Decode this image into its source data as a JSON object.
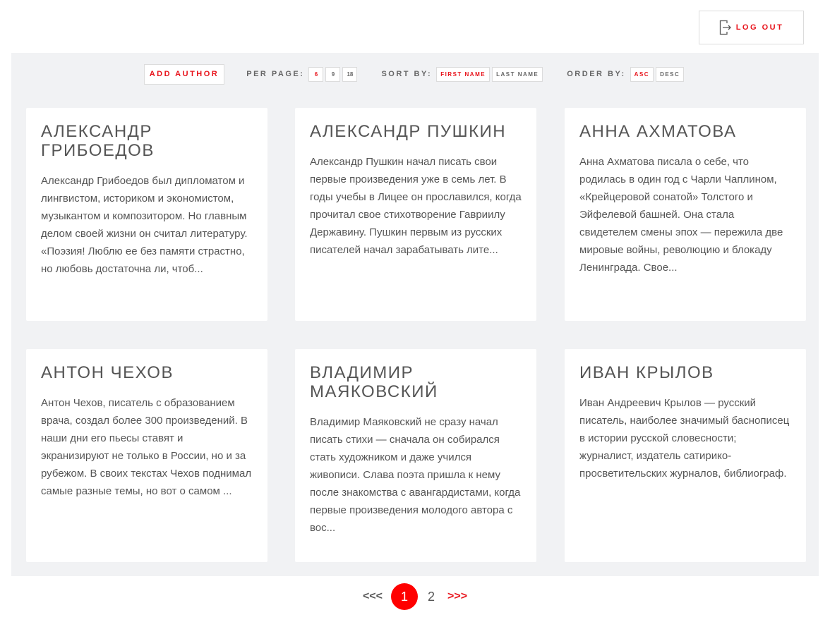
{
  "header": {
    "logout_label": "LOG OUT"
  },
  "toolbar": {
    "add_author_label": "ADD AUTHOR",
    "per_page_label": "PER PAGE:",
    "per_page_options": [
      "6",
      "9",
      "18"
    ],
    "sort_by_label": "SORT BY:",
    "sort_options": [
      "FIRST NAME",
      "LAST NAME"
    ],
    "order_by_label": "ORDER BY:",
    "order_options": [
      "ASC",
      "DESC"
    ]
  },
  "authors": [
    {
      "name": "Александр Грибоедов",
      "description": "Александр Грибоедов был дипломатом и лингвистом, историком и экономистом, музыкантом и композитором. Но главным делом своей жизни он считал литературу. «Поэзия! Люблю ее без памяти страстно, но любовь достаточна ли, чтоб..."
    },
    {
      "name": "Александр Пушкин",
      "description": "Александр Пушкин начал писать свои первые произведения уже в семь лет. В годы учебы в Лицее он прославился, когда прочитал свое стихотворение Гавриилу Державину. Пушкин первым из русских писателей начал зарабатывать лите..."
    },
    {
      "name": "Анна Ахматова",
      "description": "Анна Ахматова писала о себе, что родилась в один год с Чарли Чаплином, «Крейцеровой сонатой» Толстого и Эйфелевой башней. Она стала свидетелем смены эпох — пережила две мировые войны, революцию и блокаду Ленинграда. Свое..."
    },
    {
      "name": "Антон Чехов",
      "description": "Антон Чехов, писатель с образованием врача, создал более 300 произведений. В наши дни его пьесы ставят и экранизируют не только в России, но и за рубежом. В своих текстах Чехов поднимал самые разные темы, но вот о самом ..."
    },
    {
      "name": "Владимир Маяковский",
      "description": "Владимир Маяковский не сразу начал писать стихи — сначала он собирался стать художником и даже учился живописи. Слава поэта пришла к нему после знакомства с авангардистами, когда первые произведения молодого автора с вос..."
    },
    {
      "name": "Иван Крылов",
      "description": "Иван Андреевич Крылов — русский писатель, наиболее значимый баснописец в истории русской словесности; журналист, издатель сатирико-просветительских журналов, библиограф."
    }
  ],
  "pagination": {
    "prev_label": "<<<",
    "pages": [
      "1",
      "2"
    ],
    "next_label": ">>>"
  },
  "colors": {
    "accent": "#e8131b",
    "background": "#f1f2f4",
    "current_page": "#ff0000"
  },
  "icons": {
    "logout": "logout-icon"
  }
}
